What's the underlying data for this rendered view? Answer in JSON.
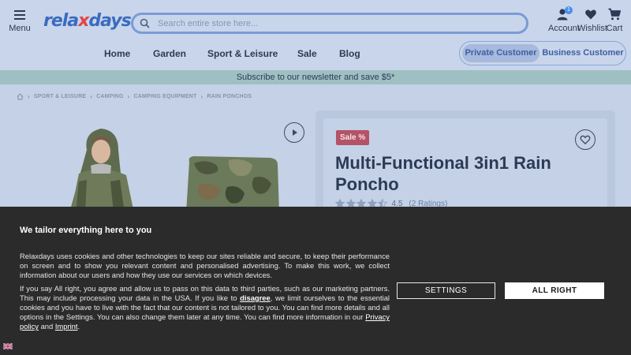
{
  "header": {
    "menu_label": "Menu",
    "logo_text_pre": "rela",
    "logo_text_x": "x",
    "logo_text_post": "days",
    "search_placeholder": "Search entire store here...",
    "account_label": "Account",
    "account_badge": "1",
    "wishlist_label": "Wishlist",
    "cart_label": "Cart"
  },
  "nav": {
    "items": [
      "Home",
      "Garden",
      "Sport & Leisure",
      "Sale",
      "Blog"
    ]
  },
  "customer_toggle": {
    "private": "Private Customer",
    "business": "Business Customer",
    "selected": "Private Customer"
  },
  "newsletter": "Subscribe to our newsletter and save $5*",
  "breadcrumb": [
    "SPORT & LEISURE",
    "CAMPING",
    "CAMPING EQUIPMENT",
    "RAIN PONCHOS"
  ],
  "product": {
    "sale_badge": "Sale %",
    "title": "Multi-Functional 3in1 Rain Poncho",
    "rating_value": "4.5",
    "rating_count": "(2 Ratings)",
    "stars_filled": 4.5,
    "stars_total": 5
  },
  "cookie": {
    "title": "We tailor everything here to you",
    "paragraph1": "Relaxdays uses cookies and other technologies to keep our sites reliable and secure, to keep their performance on screen and to show you relevant content and personalised advertising. To make this work, we collect information about our users and how they use our services on which devices.",
    "p2_a": "If you say All right, you agree and allow us to pass on this data to third parties, such as our marketing partners. This may include processing your data in the USA. If you like to ",
    "p2_disagree": "disagree",
    "p2_b": ", we limit ourselves to the essential cookies and you have to live with the fact that our content is not tailored to you. You can find more details and all options in the Settings. You can also change them later at any time. You can find more information in our ",
    "p2_privacy": "Privacy policy",
    "p2_and": " and ",
    "p2_imprint": "Imprint",
    "p2_end": ".",
    "settings_label": "SETTINGS",
    "allright_label": "ALL RIGHT"
  },
  "colors": {
    "page_bg": "#c4d1e6",
    "accent_blue": "#3a6bbf",
    "sale_red": "#b45367",
    "banner_bg": "#2b2b2b",
    "newsletter_bg": "#9fc0c3"
  }
}
